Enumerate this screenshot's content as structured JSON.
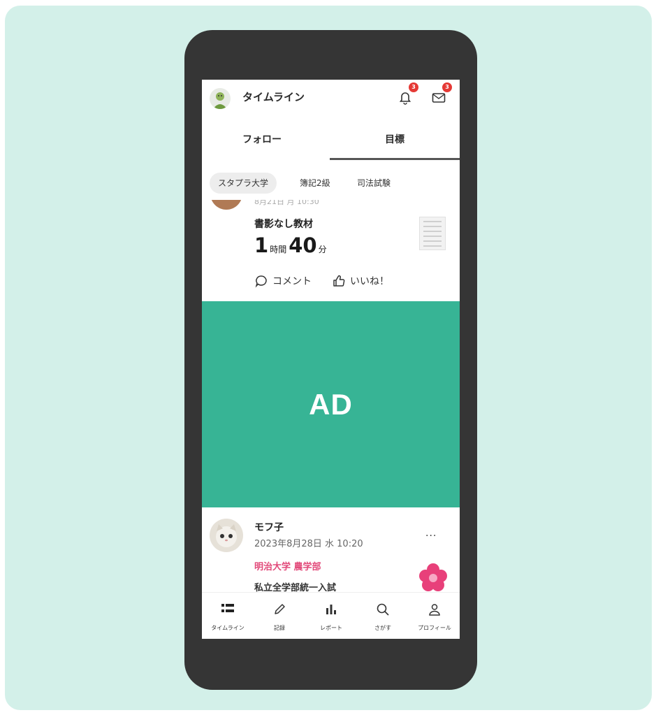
{
  "header": {
    "title": "タイムライン",
    "notification_badge": "3",
    "message_badge": "3"
  },
  "tabs": [
    {
      "label": "フォロー",
      "active": false
    },
    {
      "label": "目標",
      "active": true
    }
  ],
  "filter_chips": [
    {
      "label": "スタプラ大学",
      "active": true
    },
    {
      "label": "簿記2級",
      "active": false
    },
    {
      "label": "司法試験",
      "active": false
    }
  ],
  "post1": {
    "date": "8月21日 月 10:30",
    "material": "書影なし教材",
    "hours": "1",
    "hours_unit": "時間",
    "minutes": "40",
    "minutes_unit": "分",
    "comment_label": "コメント",
    "like_label": "いいね！"
  },
  "ad": {
    "label": "AD",
    "color": "#37b495"
  },
  "post2": {
    "name": "モフ子",
    "date": "2023年8月28日 水 10:20",
    "more": "···",
    "school": "明治大学 農学部",
    "exam": "私立全学部統一入試"
  },
  "bottom_nav": [
    {
      "label": "タイムライン",
      "icon": "list-icon"
    },
    {
      "label": "記録",
      "icon": "pencil-icon"
    },
    {
      "label": "レポート",
      "icon": "bar-chart-icon"
    },
    {
      "label": "さがす",
      "icon": "search-icon"
    },
    {
      "label": "プロフィール",
      "icon": "person-icon"
    }
  ],
  "colors": {
    "background": "#d3f0e9",
    "phone_frame": "#353535",
    "badge": "#e53935",
    "school_pink": "#e24a7a"
  }
}
